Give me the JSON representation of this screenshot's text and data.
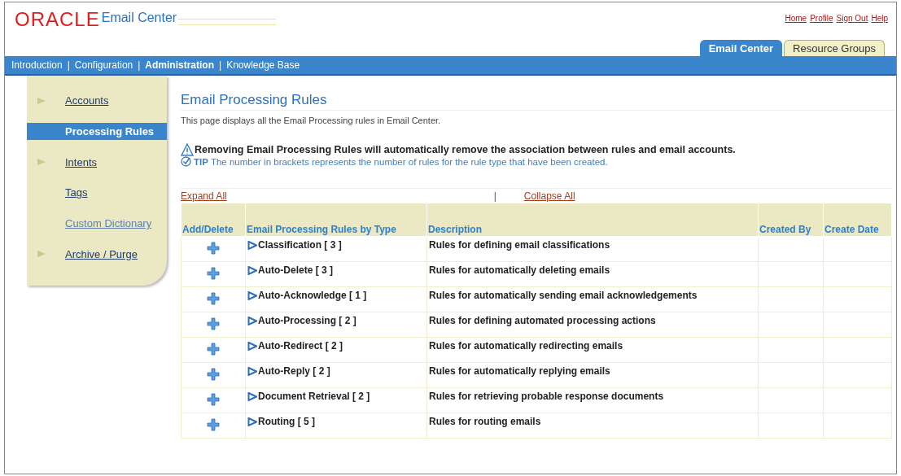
{
  "header": {
    "logo": "ORACLE",
    "product": "Email Center",
    "links": [
      "Home",
      "Profile",
      "Sign Out",
      "Help"
    ]
  },
  "tabs": [
    {
      "label": "Email Center",
      "selected": true
    },
    {
      "label": "Resource Groups",
      "selected": false
    }
  ],
  "nav_separator": "|",
  "nav": [
    {
      "label": "Introduction",
      "selected": false
    },
    {
      "label": "Configuration",
      "selected": false
    },
    {
      "label": "Administration",
      "selected": true
    },
    {
      "label": "Knowledge Base",
      "selected": false
    }
  ],
  "sidebar": {
    "items": [
      {
        "label": "Accounts",
        "kind": "arrow",
        "selected": false
      },
      {
        "label": "Processing Rules",
        "kind": "plain",
        "selected": true
      },
      {
        "label": "Intents",
        "kind": "arrow",
        "selected": false
      },
      {
        "label": "Tags",
        "kind": "plain",
        "selected": false
      },
      {
        "label": "Custom Dictionary",
        "kind": "plain",
        "selected": false
      },
      {
        "label": "Archive / Purge",
        "kind": "arrow",
        "selected": false
      }
    ]
  },
  "page": {
    "title": "Email Processing Rules",
    "description": "This page displays all the Email Processing rules in Email Center.",
    "warning": "Removing Email Processing Rules will automatically remove the association between rules and email accounts.",
    "tip_label": "TIP",
    "tip": "The number in brackets represents the number of rules for the rule type that have been created."
  },
  "table": {
    "expand_all": "Expand All",
    "separator": "|",
    "collapse_all": "Collapse All",
    "columns": [
      "Add/Delete",
      "Email Processing Rules by Type",
      "Description",
      "Created By",
      "Create Date"
    ],
    "rows": [
      {
        "type": "Classification [ 3 ]",
        "description": "Rules for defining email classifications"
      },
      {
        "type": "Auto-Delete [ 3 ]",
        "description": "Rules for automatically deleting emails"
      },
      {
        "type": "Auto-Acknowledge [ 1 ]",
        "description": "Rules for automatically sending email acknowledgements"
      },
      {
        "type": "Auto-Processing [ 2 ]",
        "description": "Rules for defining automated processing actions"
      },
      {
        "type": "Auto-Redirect [ 2 ]",
        "description": "Rules for automatically redirecting emails"
      },
      {
        "type": "Auto-Reply [ 2 ]",
        "description": "Rules for automatically replying emails"
      },
      {
        "type": "Document Retrieval [ 2 ]",
        "description": "Rules for retrieving probable response documents"
      },
      {
        "type": "Routing [ 5 ]",
        "description": "Rules for routing emails"
      }
    ]
  }
}
